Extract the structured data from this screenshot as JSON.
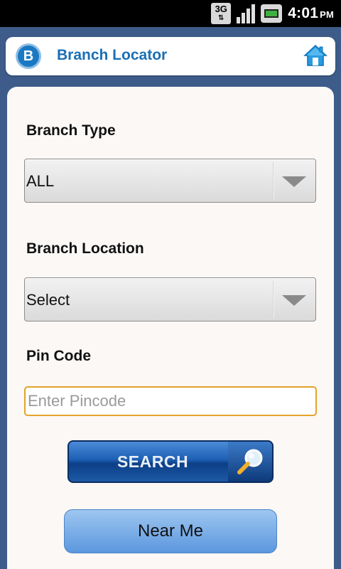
{
  "status_bar": {
    "network": "3G",
    "time": "4:01",
    "ampm": "PM"
  },
  "header": {
    "logo_letter": "B",
    "title": "Branch Locator",
    "home_icon": "home-icon"
  },
  "form": {
    "branch_type_label": "Branch Type",
    "branch_type_value": "ALL",
    "branch_location_label": "Branch Location",
    "branch_location_value": "Select",
    "pin_code_label": "Pin Code",
    "pin_code_placeholder": "Enter Pincode",
    "pin_code_value": "",
    "search_label": "SEARCH",
    "near_me_label": "Near Me"
  },
  "colors": {
    "background": "#3d5c8a",
    "title": "#1a6fb5",
    "input_focus": "#e3a32a",
    "search_button": "#1d5fb4",
    "near_me_button": "#7db0e8"
  }
}
